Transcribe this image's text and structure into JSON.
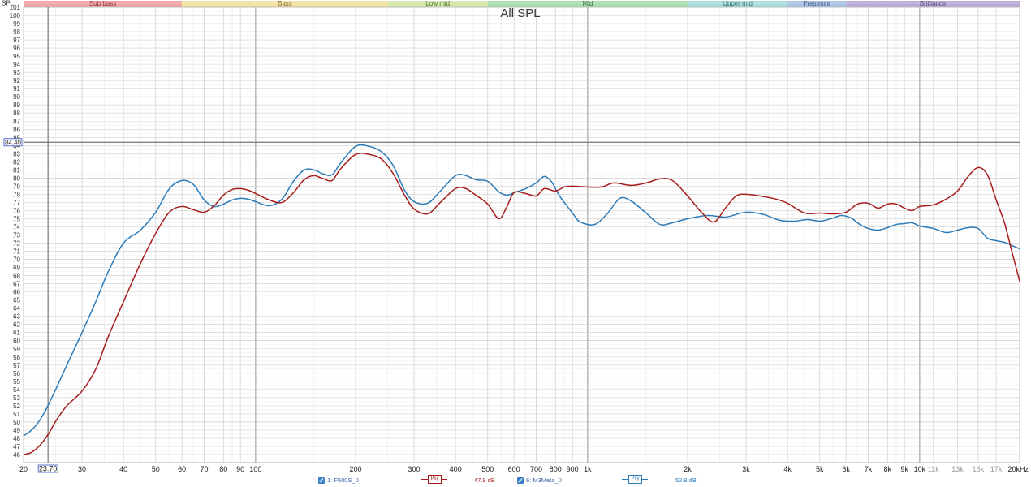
{
  "chart_data": {
    "type": "line",
    "title": "All SPL",
    "ylabel": "SPL",
    "xscale": "log",
    "xlim": [
      20,
      20000
    ],
    "ylim": [
      45,
      101
    ],
    "grid": true,
    "y_ticks": [
      "46",
      "47",
      "48",
      "49",
      "50",
      "51",
      "52",
      "53",
      "54",
      "55",
      "56",
      "57",
      "58",
      "59",
      "60",
      "61",
      "62",
      "63",
      "64",
      "65",
      "66",
      "67",
      "68",
      "69",
      "70",
      "71",
      "72",
      "73",
      "74",
      "75",
      "76",
      "77",
      "78",
      "79",
      "80",
      "81",
      "82",
      "83",
      "84",
      "85",
      "86",
      "87",
      "88",
      "89",
      "90",
      "91",
      "92",
      "93",
      "94",
      "95",
      "96",
      "97",
      "98",
      "99",
      "100",
      "101"
    ],
    "x_ticks": [
      {
        "f": 20,
        "label": "20",
        "minor": false
      },
      {
        "f": 30,
        "label": "30",
        "minor": false
      },
      {
        "f": 40,
        "label": "40",
        "minor": false
      },
      {
        "f": 50,
        "label": "50",
        "minor": false
      },
      {
        "f": 60,
        "label": "60",
        "minor": false
      },
      {
        "f": 70,
        "label": "70",
        "minor": false
      },
      {
        "f": 80,
        "label": "80",
        "minor": false
      },
      {
        "f": 90,
        "label": "90",
        "minor": false
      },
      {
        "f": 100,
        "label": "100",
        "minor": false
      },
      {
        "f": 200,
        "label": "200",
        "minor": false
      },
      {
        "f": 300,
        "label": "300",
        "minor": false
      },
      {
        "f": 400,
        "label": "400",
        "minor": false
      },
      {
        "f": 500,
        "label": "500",
        "minor": false
      },
      {
        "f": 600,
        "label": "600",
        "minor": false
      },
      {
        "f": 700,
        "label": "700",
        "minor": false
      },
      {
        "f": 800,
        "label": "800",
        "minor": false
      },
      {
        "f": 900,
        "label": "900",
        "minor": false
      },
      {
        "f": 1000,
        "label": "1k",
        "minor": false
      },
      {
        "f": 2000,
        "label": "2k",
        "minor": false
      },
      {
        "f": 3000,
        "label": "3k",
        "minor": false
      },
      {
        "f": 4000,
        "label": "4k",
        "minor": false
      },
      {
        "f": 5000,
        "label": "5k",
        "minor": false
      },
      {
        "f": 6000,
        "label": "6k",
        "minor": false
      },
      {
        "f": 7000,
        "label": "7k",
        "minor": false
      },
      {
        "f": 8000,
        "label": "8k",
        "minor": false
      },
      {
        "f": 9000,
        "label": "9k",
        "minor": false
      },
      {
        "f": 10000,
        "label": "10k",
        "minor": false
      },
      {
        "f": 11000,
        "label": "11k",
        "minor": true
      },
      {
        "f": 13000,
        "label": "13k",
        "minor": true
      },
      {
        "f": 15000,
        "label": "15k",
        "minor": true
      },
      {
        "f": 17000,
        "label": "17k",
        "minor": true
      },
      {
        "f": 20000,
        "label": "20kHz",
        "minor": false
      }
    ],
    "bands": [
      {
        "name": "Sub bass",
        "from": 20,
        "to": 60,
        "color": "#f4a3a3",
        "text": "#8a3030"
      },
      {
        "name": "Bass",
        "from": 60,
        "to": 250,
        "color": "#f5e3a0",
        "text": "#7a6520"
      },
      {
        "name": "Low mid",
        "from": 250,
        "to": 500,
        "color": "#d4eaa6",
        "text": "#4a6a20"
      },
      {
        "name": "Mid",
        "from": 500,
        "to": 2000,
        "color": "#a9deae",
        "text": "#2f6a35"
      },
      {
        "name": "Upper mid",
        "from": 2000,
        "to": 4000,
        "color": "#a7dede",
        "text": "#2d6868"
      },
      {
        "name": "Presence",
        "from": 4000,
        "to": 6000,
        "color": "#a9c3e6",
        "text": "#304f7a"
      },
      {
        "name": "Brilliance",
        "from": 6000,
        "to": 20000,
        "color": "#b9a9d6",
        "text": "#4f3c78"
      }
    ],
    "cursor": {
      "x_label": "23.70",
      "x": 23.7,
      "y_label": "84.40",
      "y": 84.4
    },
    "series": [
      {
        "name": "F500S_0",
        "color": "#a61c1c",
        "points": [
          [
            20,
            46.0
          ],
          [
            21,
            46.2
          ],
          [
            22,
            46.8
          ],
          [
            23,
            47.7
          ],
          [
            24,
            48.8
          ],
          [
            25,
            50.1
          ],
          [
            27,
            52.0
          ],
          [
            30,
            53.8
          ],
          [
            33,
            56.5
          ],
          [
            36,
            60.5
          ],
          [
            40,
            64.8
          ],
          [
            45,
            69.5
          ],
          [
            50,
            73.2
          ],
          [
            55,
            75.8
          ],
          [
            60,
            76.5
          ],
          [
            65,
            76.1
          ],
          [
            70,
            75.8
          ],
          [
            75,
            76.6
          ],
          [
            80,
            77.9
          ],
          [
            85,
            78.6
          ],
          [
            90,
            78.7
          ],
          [
            95,
            78.5
          ],
          [
            100,
            78.1
          ],
          [
            110,
            77.3
          ],
          [
            120,
            77.0
          ],
          [
            130,
            78.2
          ],
          [
            140,
            79.8
          ],
          [
            150,
            80.3
          ],
          [
            160,
            79.9
          ],
          [
            170,
            79.7
          ],
          [
            180,
            81.1
          ],
          [
            200,
            82.9
          ],
          [
            220,
            82.9
          ],
          [
            240,
            82.3
          ],
          [
            260,
            80.5
          ],
          [
            280,
            78.0
          ],
          [
            300,
            76.2
          ],
          [
            330,
            75.6
          ],
          [
            360,
            77.0
          ],
          [
            400,
            78.7
          ],
          [
            430,
            78.7
          ],
          [
            460,
            77.9
          ],
          [
            500,
            76.8
          ],
          [
            540,
            75.0
          ],
          [
            570,
            76.4
          ],
          [
            600,
            78.2
          ],
          [
            650,
            78.1
          ],
          [
            700,
            77.8
          ],
          [
            740,
            78.7
          ],
          [
            800,
            78.4
          ],
          [
            850,
            78.9
          ],
          [
            900,
            79.0
          ],
          [
            1000,
            78.9
          ],
          [
            1100,
            78.9
          ],
          [
            1200,
            79.4
          ],
          [
            1350,
            79.1
          ],
          [
            1500,
            79.4
          ],
          [
            1650,
            79.9
          ],
          [
            1800,
            79.7
          ],
          [
            2000,
            77.8
          ],
          [
            2200,
            75.8
          ],
          [
            2400,
            74.6
          ],
          [
            2600,
            76.3
          ],
          [
            2800,
            77.8
          ],
          [
            3000,
            78.0
          ],
          [
            3300,
            77.8
          ],
          [
            3700,
            77.4
          ],
          [
            4000,
            76.9
          ],
          [
            4500,
            75.7
          ],
          [
            5000,
            75.7
          ],
          [
            5500,
            75.6
          ],
          [
            6000,
            75.8
          ],
          [
            6500,
            76.8
          ],
          [
            7000,
            76.9
          ],
          [
            7500,
            76.3
          ],
          [
            8000,
            76.8
          ],
          [
            8500,
            76.8
          ],
          [
            9000,
            76.3
          ],
          [
            9500,
            76.0
          ],
          [
            10000,
            76.5
          ],
          [
            11000,
            76.7
          ],
          [
            12000,
            77.4
          ],
          [
            13000,
            78.4
          ],
          [
            14000,
            80.2
          ],
          [
            15000,
            81.3
          ],
          [
            16000,
            80.4
          ],
          [
            17000,
            77.3
          ],
          [
            18000,
            74.5
          ],
          [
            19000,
            70.8
          ],
          [
            20000,
            67.3
          ]
        ]
      },
      {
        "name": "M3Meta_0",
        "color": "#2b7bb9",
        "points": [
          [
            20,
            48.3
          ],
          [
            21,
            48.9
          ],
          [
            22,
            49.8
          ],
          [
            23,
            51.0
          ],
          [
            24,
            52.5
          ],
          [
            25,
            54.0
          ],
          [
            27,
            57.0
          ],
          [
            30,
            61.0
          ],
          [
            33,
            64.8
          ],
          [
            36,
            68.5
          ],
          [
            40,
            72.0
          ],
          [
            45,
            73.6
          ],
          [
            50,
            75.8
          ],
          [
            55,
            78.7
          ],
          [
            60,
            79.7
          ],
          [
            65,
            79.2
          ],
          [
            70,
            77.3
          ],
          [
            75,
            76.5
          ],
          [
            80,
            76.8
          ],
          [
            85,
            77.3
          ],
          [
            90,
            77.5
          ],
          [
            95,
            77.4
          ],
          [
            100,
            77.1
          ],
          [
            110,
            76.6
          ],
          [
            120,
            77.4
          ],
          [
            130,
            79.6
          ],
          [
            140,
            81.0
          ],
          [
            150,
            81.0
          ],
          [
            160,
            80.5
          ],
          [
            170,
            80.4
          ],
          [
            180,
            81.8
          ],
          [
            200,
            83.9
          ],
          [
            220,
            83.9
          ],
          [
            240,
            83.2
          ],
          [
            260,
            81.5
          ],
          [
            280,
            78.6
          ],
          [
            300,
            77.1
          ],
          [
            330,
            76.9
          ],
          [
            360,
            78.4
          ],
          [
            400,
            80.3
          ],
          [
            430,
            80.3
          ],
          [
            460,
            79.8
          ],
          [
            500,
            79.6
          ],
          [
            540,
            78.3
          ],
          [
            570,
            77.9
          ],
          [
            600,
            78.2
          ],
          [
            650,
            78.7
          ],
          [
            700,
            79.4
          ],
          [
            740,
            80.2
          ],
          [
            780,
            79.5
          ],
          [
            820,
            77.9
          ],
          [
            900,
            75.7
          ],
          [
            950,
            74.6
          ],
          [
            1050,
            74.3
          ],
          [
            1150,
            75.7
          ],
          [
            1250,
            77.5
          ],
          [
            1350,
            77.2
          ],
          [
            1500,
            75.7
          ],
          [
            1650,
            74.3
          ],
          [
            1800,
            74.5
          ],
          [
            2000,
            75.0
          ],
          [
            2300,
            75.4
          ],
          [
            2600,
            75.2
          ],
          [
            2900,
            75.7
          ],
          [
            3100,
            75.8
          ],
          [
            3400,
            75.5
          ],
          [
            3800,
            74.8
          ],
          [
            4200,
            74.7
          ],
          [
            4600,
            74.9
          ],
          [
            5000,
            74.7
          ],
          [
            5400,
            75.0
          ],
          [
            5800,
            75.4
          ],
          [
            6200,
            75.1
          ],
          [
            6600,
            74.3
          ],
          [
            7000,
            73.8
          ],
          [
            7500,
            73.6
          ],
          [
            8000,
            73.9
          ],
          [
            8500,
            74.3
          ],
          [
            9000,
            74.4
          ],
          [
            9500,
            74.5
          ],
          [
            10000,
            74.1
          ],
          [
            11000,
            73.8
          ],
          [
            12000,
            73.3
          ],
          [
            13000,
            73.6
          ],
          [
            14000,
            73.9
          ],
          [
            15000,
            73.8
          ],
          [
            16000,
            72.6
          ],
          [
            17000,
            72.3
          ],
          [
            18000,
            72.1
          ],
          [
            19000,
            71.7
          ],
          [
            20000,
            71.3
          ]
        ]
      }
    ]
  },
  "legend": {
    "items": [
      {
        "label": "1: F500S_0",
        "smoothing": "Psy",
        "value": "47.9 dB",
        "color": "#a61c1c"
      },
      {
        "label": "6: M3Meta_0",
        "smoothing": "Psy",
        "value": "52.8 dB",
        "color": "#2b7bb9"
      }
    ]
  },
  "colors": {
    "grid_major": "#cfcfcf",
    "grid_minor": "#e8e8e8",
    "cursor": "#6b6b6b",
    "cursor_label": "#2a4fc4"
  }
}
